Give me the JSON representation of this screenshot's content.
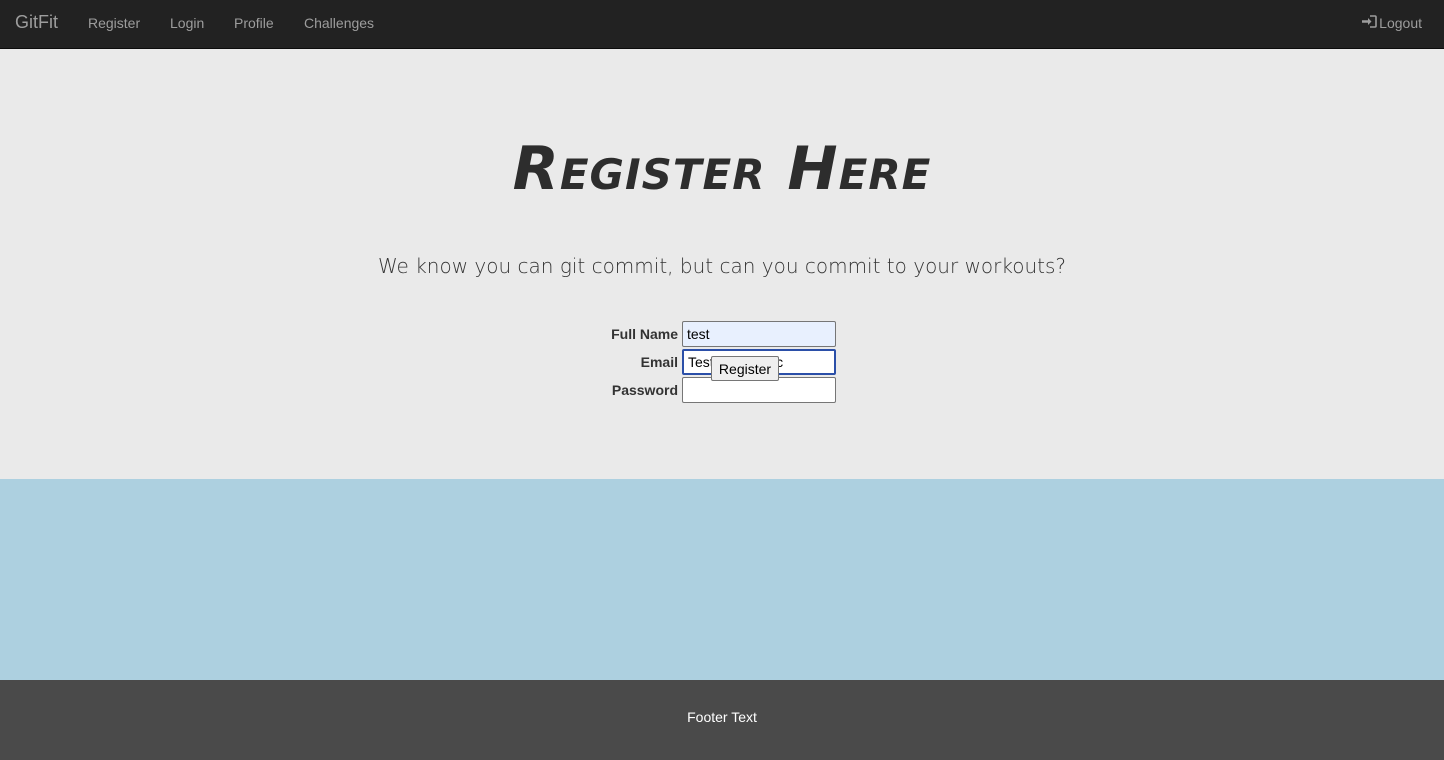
{
  "navbar": {
    "brand": "GitFit",
    "links": [
      "Register",
      "Login",
      "Profile",
      "Challenges"
    ],
    "logout_label": "Logout",
    "logout_icon": "sign-in-icon"
  },
  "hero": {
    "title": "Register Here",
    "subtitle": "We know you can git commit, but can you commit to your workouts?"
  },
  "form": {
    "full_name_label": "Full Name",
    "full_name_value": "test",
    "email_label": "Email",
    "email_value": "Testing@Test.c",
    "password_label": "Password",
    "password_value": "",
    "submit_label": "Register"
  },
  "footer": {
    "text": "Footer Text"
  },
  "colors": {
    "navbar_bg": "#222222",
    "hero_bg": "#eaeaea",
    "band_bg": "#add0e0",
    "footer_bg": "#4a4a4a"
  }
}
